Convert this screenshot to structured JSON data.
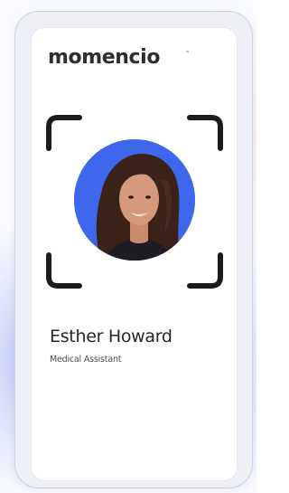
{
  "brand": {
    "logo_text": "momencio",
    "trademark": "™"
  },
  "profile": {
    "name": "Esther Howard",
    "role": "Medical Assistant",
    "photo_background_color": "#3f67ee"
  },
  "colors": {
    "frame_corners": "#1c1c1f",
    "text_primary": "#25252a",
    "card_background": "#ffffff"
  },
  "icons": {
    "scan_frame": "viewfinder-corners-icon"
  }
}
